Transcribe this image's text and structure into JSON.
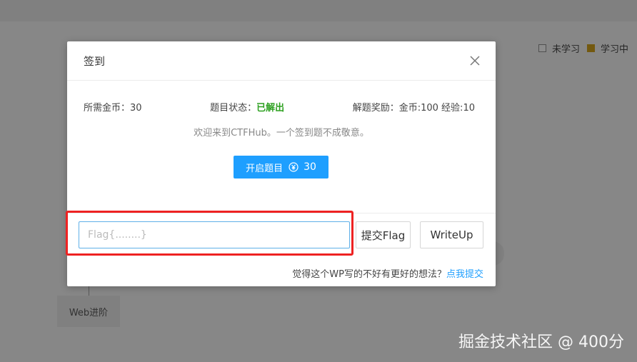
{
  "background": {
    "legend": [
      {
        "label": "未学习"
      },
      {
        "label": "学习中"
      }
    ],
    "node_label": "Web进阶"
  },
  "modal": {
    "title": "签到",
    "info": {
      "coins_label": "所需金币：",
      "coins_value": "30",
      "status_label": "题目状态：",
      "status_value": "已解出",
      "reward_label": "解题奖励：",
      "reward_value": "金币:100 经验:10"
    },
    "welcome": "欢迎来到CTFHub。一个签到题不成敬意。",
    "start_button": {
      "label": "开启题目",
      "cost": "30"
    },
    "flag_input": {
      "placeholder": "Flag{........}",
      "value": ""
    },
    "submit_label": "提交Flag",
    "writeup_label": "WriteUp",
    "footer": {
      "text": "觉得这个WP写的不好有更好的想法？",
      "link": "点我提交"
    }
  },
  "watermark": "掘金技术社区 @ 400分",
  "colors": {
    "accent": "#1e9fff",
    "solved": "#2ea121",
    "highlight": "#ee2222",
    "legend_fill": "#c79a1a"
  },
  "icons": {
    "close": "close-icon",
    "coin": "yuan-coin-icon"
  }
}
